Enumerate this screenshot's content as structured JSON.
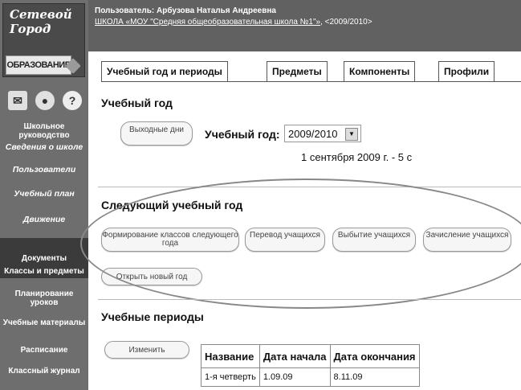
{
  "logo": {
    "line1": "Сетевой",
    "line2": "Город",
    "line3": "ОБРАЗОВАНИЕ"
  },
  "sidebar": {
    "icons": [
      "mail-icon",
      "users-icon",
      "help-icon"
    ],
    "items": [
      {
        "label": "Школьное руководство"
      },
      {
        "label": "Сведения о школе"
      },
      {
        "label": "Пользователи"
      },
      {
        "label": "Учебный план"
      },
      {
        "label": "Движение"
      },
      {
        "label": "Документы"
      },
      {
        "label": "Классы и предметы"
      },
      {
        "label": "Планирование уроков"
      },
      {
        "label": "Учебные материалы"
      },
      {
        "label": "Расписание"
      },
      {
        "label": "Классный журнал"
      }
    ]
  },
  "header": {
    "user": "Пользователь: Арбузова Наталья Андреевна",
    "school_link": "ШКОЛА «МОУ \"Средняя общеобразовательная школа №1\"»",
    "year": ", <2009/2010>"
  },
  "tabs": [
    "Учебный год и периоды",
    "Предметы",
    "Компоненты",
    "Профили"
  ],
  "school_year": {
    "title": "Учебный год",
    "holidays_button": "Выходные дни",
    "year_label": "Учебный год:",
    "year_value": "2009/2010",
    "date_range": "1 сентября 2009 г. - 5 с"
  },
  "next_year": {
    "title": "Следующий учебный год",
    "buttons": [
      "Формирование классов следующего года",
      "Перевод учащихся",
      "Выбытие учащихся",
      "Зачисление учащихся",
      "Открыть новый год"
    ]
  },
  "periods": {
    "title": "Учебные периоды",
    "edit_button": "Изменить",
    "columns": [
      "Название",
      "Дата начала",
      "Дата окончания"
    ],
    "rows": [
      [
        "1-я четверть",
        "1.09.09",
        "8.11.09"
      ]
    ]
  }
}
